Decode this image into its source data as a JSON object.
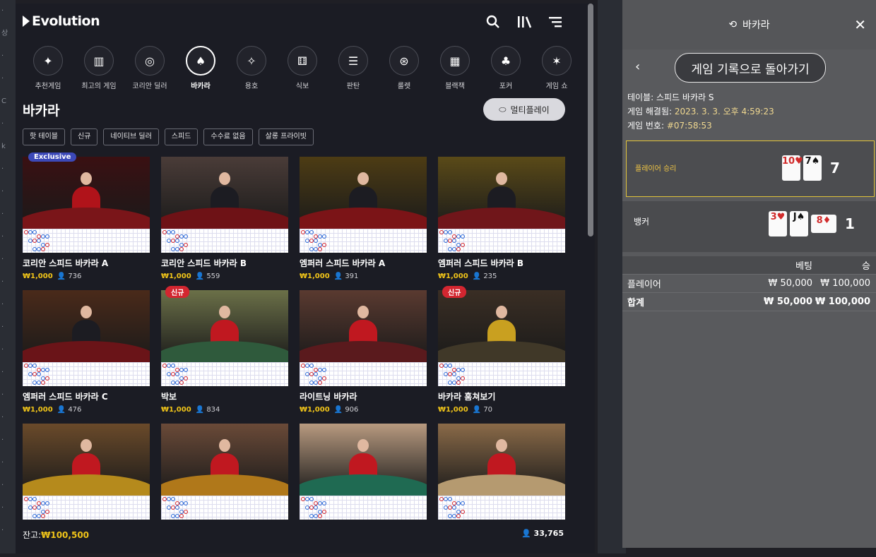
{
  "lobby": {
    "logo": "Evolution",
    "categories": [
      "추천게임",
      "최고의 게임",
      "코리안 딜러",
      "바카라",
      "용호",
      "식보",
      "판탄",
      "룰렛",
      "블랙잭",
      "포커",
      "게임 쇼"
    ],
    "active_category": "바카라",
    "page_title": "바카라",
    "multiplay_label": "멀티플레이",
    "filters": [
      "핫 테이블",
      "신규",
      "네이티브 딜러",
      "스피드",
      "수수료 없음",
      "살롱 프라이빗"
    ],
    "badges": {
      "exclusive": "Exclusive",
      "new": "신규"
    },
    "tables": [
      {
        "name": "코리안 스피드 바카라 A",
        "bet": "₩1,000",
        "players": "736",
        "badge": "exclusive"
      },
      {
        "name": "코리안 스피드 바카라 B",
        "bet": "₩1,000",
        "players": "559",
        "badge": ""
      },
      {
        "name": "엠퍼러 스피드 바카라 A",
        "bet": "₩1,000",
        "players": "391",
        "badge": ""
      },
      {
        "name": "엠퍼러 스피드 바카라 B",
        "bet": "₩1,000",
        "players": "235",
        "badge": ""
      },
      {
        "name": "엠퍼러 스피드 바카라 C",
        "bet": "₩1,000",
        "players": "476",
        "badge": ""
      },
      {
        "name": "박보",
        "bet": "₩1,000",
        "players": "834",
        "badge": "new"
      },
      {
        "name": "라이트닝 바카라",
        "bet": "₩1,000",
        "players": "906",
        "badge": ""
      },
      {
        "name": "바카라 훔쳐보기",
        "bet": "₩1,000",
        "players": "70",
        "badge": "new"
      },
      {
        "name": "",
        "bet": "",
        "players": "",
        "badge": ""
      },
      {
        "name": "",
        "bet": "",
        "players": "",
        "badge": ""
      },
      {
        "name": "",
        "bet": "",
        "players": "",
        "badge": ""
      },
      {
        "name": "",
        "bet": "",
        "players": "",
        "badge": ""
      }
    ],
    "balance_label": "잔고:",
    "balance_value": "₩100,500",
    "online_count": "33,765"
  },
  "panel": {
    "title": "바카라",
    "back_label": "게임 기록으로 돌아가기",
    "table_line": "테이블: 스피드 바카라 S",
    "resolved_label": "게임 해결됨:",
    "resolved_value": "2023. 3. 3. 오후 4:59:23",
    "round_label": "게임 번호:",
    "round_value": "#07:58:53",
    "player_label": "플레이어 승리",
    "player_cards": [
      "10♥",
      "7♠"
    ],
    "player_total": "7",
    "banker_label": "뱅커",
    "banker_cards": [
      "3♥",
      "J♠",
      "8♦"
    ],
    "banker_total": "1",
    "bet_header": [
      "",
      "베팅",
      "승"
    ],
    "rows": [
      [
        "플레이어",
        "₩ 50,000",
        "₩ 100,000"
      ],
      [
        "합계",
        "₩ 50,000",
        "₩ 100,000"
      ]
    ]
  },
  "colors": {
    "gold": "#f0c419",
    "exclusive": "#3c49b8",
    "new_badge": "#d32630",
    "felt_red": "#8e1b1f",
    "felt_green": "#2c6a4a"
  }
}
